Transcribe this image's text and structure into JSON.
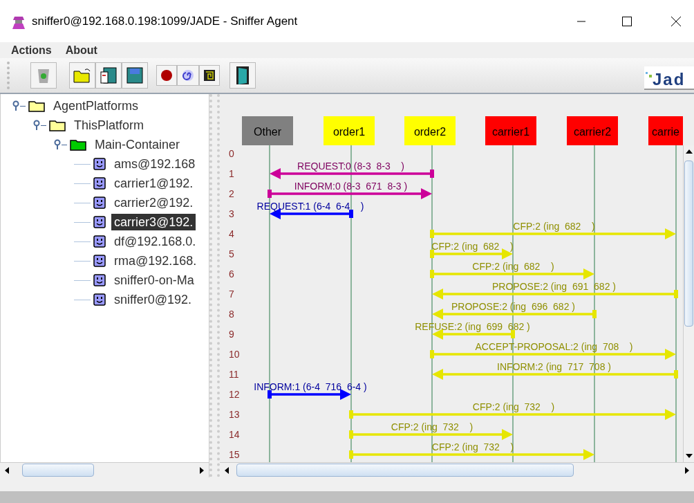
{
  "window": {
    "title": "sniffer0@192.168.0.198:1099/JADE - Sniffer Agent"
  },
  "menu": [
    "Actions",
    "About"
  ],
  "logo": {
    "text": "Jad"
  },
  "tree": [
    {
      "label": "AgentPlatforms",
      "kind": "folder",
      "expanded": true,
      "children": [
        {
          "label": "ThisPlatform",
          "kind": "folder",
          "expanded": true,
          "children": [
            {
              "label": "Main-Container",
              "kind": "container",
              "expanded": true,
              "children": [
                {
                  "label": "ams@192.168",
                  "kind": "agent",
                  "selected": false
                },
                {
                  "label": "carrier1@192.",
                  "kind": "agent",
                  "selected": false
                },
                {
                  "label": "carrier2@192.",
                  "kind": "agent",
                  "selected": false
                },
                {
                  "label": "carrier3@192.",
                  "kind": "agent",
                  "selected": true
                },
                {
                  "label": "df@192.168.0.",
                  "kind": "agent",
                  "selected": false
                },
                {
                  "label": "rma@192.168.",
                  "kind": "agent",
                  "selected": false
                },
                {
                  "label": "sniffer0-on-Ma",
                  "kind": "agent",
                  "selected": false
                },
                {
                  "label": "sniffer0@192.",
                  "kind": "agent",
                  "selected": false
                }
              ]
            }
          ]
        }
      ]
    }
  ],
  "agents": [
    {
      "name": "Other",
      "color": "#808080"
    },
    {
      "name": "order1",
      "color": "#ffff00"
    },
    {
      "name": "order2",
      "color": "#ffff00"
    },
    {
      "name": "carrier1",
      "color": "#ff0000"
    },
    {
      "name": "carrier2",
      "color": "#ff0000"
    },
    {
      "name": "carrie",
      "color": "#ff0000"
    }
  ],
  "row_numbers": [
    "0",
    "1",
    "2",
    "3",
    "4",
    "5",
    "6",
    "7",
    "8",
    "9",
    "10",
    "11",
    "12",
    "13",
    "14",
    "15"
  ],
  "messages": [
    {
      "label": "REQUEST:0 (8-3  8-3    )",
      "color": "#cc0099"
    },
    {
      "label": "INFORM:0 (8-3  671  8-3 )",
      "color": "#cc0099"
    },
    {
      "label": "REQUEST:1 (6-4  6-4    )",
      "color": "#0000ff"
    },
    {
      "label": "CFP:2 (ing  682    )",
      "color": "#e6e600"
    },
    {
      "label": "CFP:2 (ing  682    )",
      "color": "#e6e600"
    },
    {
      "label": "CFP:2 (ing  682    )",
      "color": "#e6e600"
    },
    {
      "label": "PROPOSE:2 (ing  691  682 )",
      "color": "#e6e600"
    },
    {
      "label": "PROPOSE:2 (ing  696  682 )",
      "color": "#e6e600"
    },
    {
      "label": "REFUSE:2 (ing  699  682 )",
      "color": "#e6e600"
    },
    {
      "label": "ACCEPT-PROPOSAL:2 (ing  708    )",
      "color": "#e6e600"
    },
    {
      "label": "INFORM:2 (ing  717  708 )",
      "color": "#e6e600"
    },
    {
      "label": "INFORM:1 (6-4  716  6-4 )",
      "color": "#0000ff"
    },
    {
      "label": "CFP:2 (ing  732    )",
      "color": "#e6e600"
    },
    {
      "label": "CFP:2 (ing  732    )",
      "color": "#e6e600"
    },
    {
      "label": "CFP:2 (ing  732    )",
      "color": "#e6e600"
    }
  ]
}
